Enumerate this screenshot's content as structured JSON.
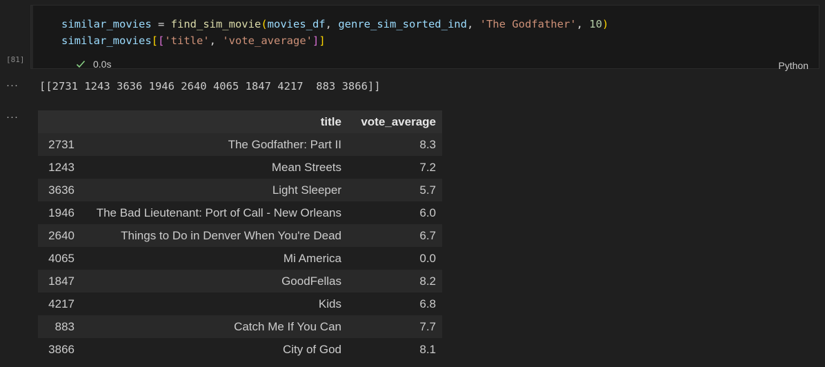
{
  "cell": {
    "execution_count": "[81]",
    "status_time": "0.0s",
    "language": "Python",
    "code": {
      "line1": {
        "var": "similar_movies",
        "assign": " = ",
        "func": "find_sim_movie",
        "open": "(",
        "arg1": "movies_df",
        "sep1": ", ",
        "arg2": "genre_sim_sorted_ind",
        "sep2": ", ",
        "arg3": "'The Godfather'",
        "sep3": ", ",
        "arg4": "10",
        "close": ")"
      },
      "line2": {
        "var": "similar_movies",
        "open1": "[",
        "open2": "[",
        "str1": "'title'",
        "sep": ", ",
        "str2": "'vote_average'",
        "close2": "]",
        "close1": "]"
      }
    }
  },
  "outputs": {
    "ellipsis": "···",
    "array_text": "[[2731 1243 3636 1946 2640 4065 1847 4217  883 3866]]",
    "table": {
      "columns": [
        "",
        "title",
        "vote_average"
      ],
      "rows": [
        {
          "index": "2731",
          "title": "The Godfather: Part II",
          "vote_average": "8.3"
        },
        {
          "index": "1243",
          "title": "Mean Streets",
          "vote_average": "7.2"
        },
        {
          "index": "3636",
          "title": "Light Sleeper",
          "vote_average": "5.7"
        },
        {
          "index": "1946",
          "title": "The Bad Lieutenant: Port of Call - New Orleans",
          "vote_average": "6.0"
        },
        {
          "index": "2640",
          "title": "Things to Do in Denver When You're Dead",
          "vote_average": "6.7"
        },
        {
          "index": "4065",
          "title": "Mi America",
          "vote_average": "0.0"
        },
        {
          "index": "1847",
          "title": "GoodFellas",
          "vote_average": "8.2"
        },
        {
          "index": "4217",
          "title": "Kids",
          "vote_average": "6.8"
        },
        {
          "index": "883",
          "title": "Catch Me If You Can",
          "vote_average": "7.7"
        },
        {
          "index": "3866",
          "title": "City of God",
          "vote_average": "8.1"
        }
      ]
    }
  },
  "colors": {
    "background": "#1f1f1f",
    "cell_background": "#181818",
    "success_check": "#89d185"
  },
  "icons": {
    "status": "check-icon",
    "output_menu": "ellipsis-icon"
  }
}
